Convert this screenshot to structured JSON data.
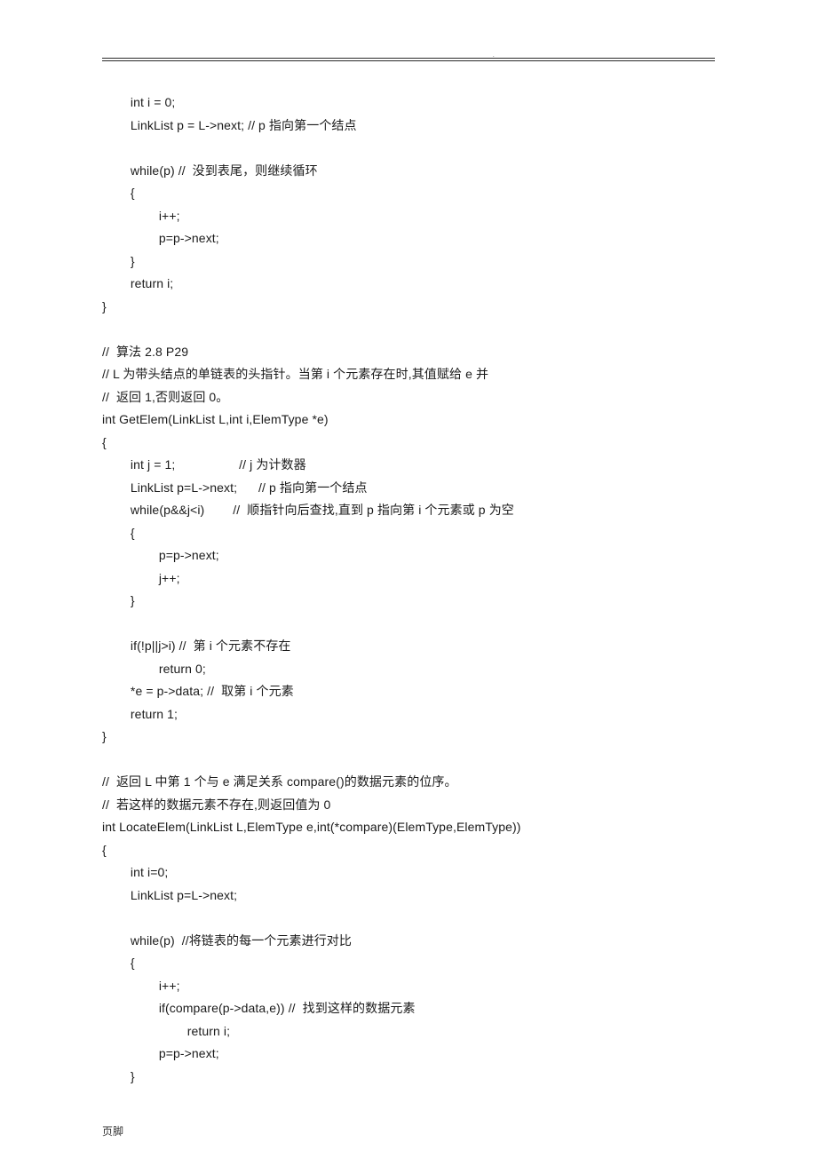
{
  "header_mark": ".",
  "footer": "页脚",
  "code_lines": [
    "\tint i = 0;",
    "\tLinkList p = L->next; // p 指向第一个结点",
    "",
    "\twhile(p) //  没到表尾，则继续循环",
    "\t{",
    "\t\ti++;",
    "\t\tp=p->next;",
    "\t}",
    "\treturn i;",
    "}",
    "",
    "//  算法 2.8 P29",
    "// L 为带头结点的单链表的头指针。当第 i 个元素存在时,其值赋给 e 并",
    "//  返回 1,否则返回 0。",
    "int GetElem(LinkList L,int i,ElemType *e)",
    "{",
    "\tint j = 1;                  // j 为计数器",
    "\tLinkList p=L->next;      // p 指向第一个结点",
    "\twhile(p&&j<i)        //  顺指针向后查找,直到 p 指向第 i 个元素或 p 为空",
    "\t{",
    "\t\tp=p->next;",
    "\t\tj++;",
    "\t}",
    "",
    "\tif(!p||j>i) //  第 i 个元素不存在",
    "\t\treturn 0;",
    "\t*e = p->data; //  取第 i 个元素",
    "\treturn 1;",
    "}",
    "",
    "//  返回 L 中第 1 个与 e 满足关系 compare()的数据元素的位序。",
    "//  若这样的数据元素不存在,则返回值为 0",
    "int LocateElem(LinkList L,ElemType e,int(*compare)(ElemType,ElemType))",
    "{",
    "\tint i=0;",
    "\tLinkList p=L->next;",
    "",
    "\twhile(p)  //将链表的每一个元素进行对比",
    "\t{",
    "\t\ti++;",
    "\t\tif(compare(p->data,e)) //  找到这样的数据元素",
    "\t\t\treturn i;",
    "\t\tp=p->next;",
    "\t}"
  ]
}
